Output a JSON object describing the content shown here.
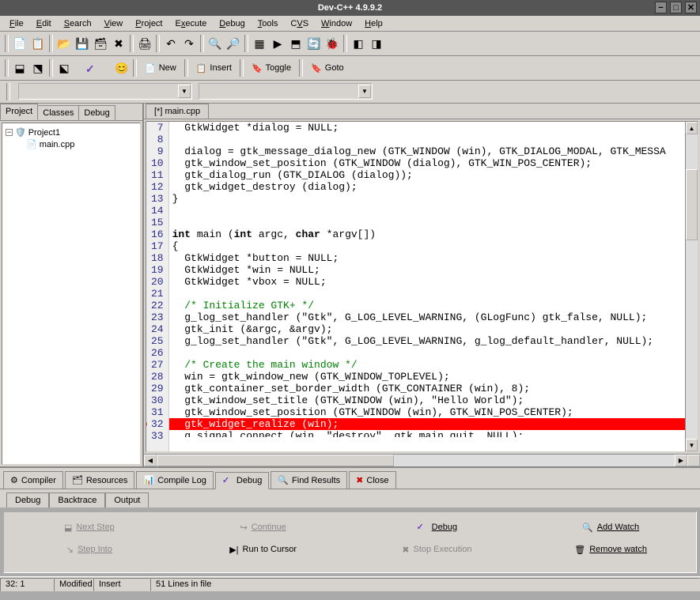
{
  "title": "Dev-C++ 4.9.9.2",
  "menu": [
    "File",
    "Edit",
    "Search",
    "View",
    "Project",
    "Execute",
    "Debug",
    "Tools",
    "CVS",
    "Window",
    "Help"
  ],
  "toolbar2": {
    "new": "New",
    "insert": "Insert",
    "toggle": "Toggle",
    "goto": "Goto"
  },
  "left_tabs": [
    "Project",
    "Classes",
    "Debug"
  ],
  "tree": {
    "root": "Project1",
    "file": "main.cpp"
  },
  "editor_tab": "[*] main.cpp",
  "code": [
    {
      "n": 7,
      "t": "  GtkWidget *dialog = NULL;"
    },
    {
      "n": 8,
      "t": ""
    },
    {
      "n": 9,
      "t": "  dialog = gtk_message_dialog_new (GTK_WINDOW (win), GTK_DIALOG_MODAL, GTK_MESSA"
    },
    {
      "n": 10,
      "t": "  gtk_window_set_position (GTK_WINDOW (dialog), GTK_WIN_POS_CENTER);"
    },
    {
      "n": 11,
      "t": "  gtk_dialog_run (GTK_DIALOG (dialog));"
    },
    {
      "n": 12,
      "t": "  gtk_widget_destroy (dialog);"
    },
    {
      "n": 13,
      "t": "}"
    },
    {
      "n": 14,
      "t": ""
    },
    {
      "n": 15,
      "t": ""
    },
    {
      "n": 16,
      "t": "int main (int argc, char *argv[])",
      "syn": "k:int|k:int|k:char"
    },
    {
      "n": 17,
      "t": "{"
    },
    {
      "n": 18,
      "t": "  GtkWidget *button = NULL;"
    },
    {
      "n": 19,
      "t": "  GtkWidget *win = NULL;"
    },
    {
      "n": 20,
      "t": "  GtkWidget *vbox = NULL;"
    },
    {
      "n": 21,
      "t": ""
    },
    {
      "n": 22,
      "t": "  /* Initialize GTK+ */",
      "c": true
    },
    {
      "n": 23,
      "t": "  g_log_set_handler (\"Gtk\", G_LOG_LEVEL_WARNING, (GLogFunc) gtk_false, NULL);"
    },
    {
      "n": 24,
      "t": "  gtk_init (&argc, &argv);"
    },
    {
      "n": 25,
      "t": "  g_log_set_handler (\"Gtk\", G_LOG_LEVEL_WARNING, g_log_default_handler, NULL);"
    },
    {
      "n": 26,
      "t": ""
    },
    {
      "n": 27,
      "t": "  /* Create the main window */",
      "c": true
    },
    {
      "n": 28,
      "t": "  win = gtk_window_new (GTK_WINDOW_TOPLEVEL);"
    },
    {
      "n": 29,
      "t": "  gtk_container_set_border_width (GTK_CONTAINER (win), 8);"
    },
    {
      "n": 30,
      "t": "  gtk_window_set_title (GTK_WINDOW (win), \"Hello World\");"
    },
    {
      "n": 31,
      "t": "  gtk_window_set_position (GTK_WINDOW (win), GTK_WIN_POS_CENTER);"
    },
    {
      "n": 32,
      "t": "  gtk_widget_realize (win);",
      "hl": true,
      "bp": true
    },
    {
      "n": 33,
      "t": "  g_signal_connect (win, \"destroy\", gtk_main_quit, NULL);",
      "cut": true
    }
  ],
  "bottom_tabs_1": [
    "Compiler",
    "Resources",
    "Compile Log",
    "Debug",
    "Find Results",
    "Close"
  ],
  "bottom_tabs_2": [
    "Debug",
    "Backtrace",
    "Output"
  ],
  "debug_buttons": {
    "next_step": "Next Step",
    "continue": "Continue",
    "debug": "Debug",
    "add_watch": "Add Watch",
    "step_into": "Step Into",
    "run_cursor": "Run to Cursor",
    "stop": "Stop Execution",
    "remove_watch": "Remove watch"
  },
  "status": {
    "pos": "32: 1",
    "modified": "Modified",
    "mode": "Insert",
    "lines": "51 Lines in file"
  }
}
